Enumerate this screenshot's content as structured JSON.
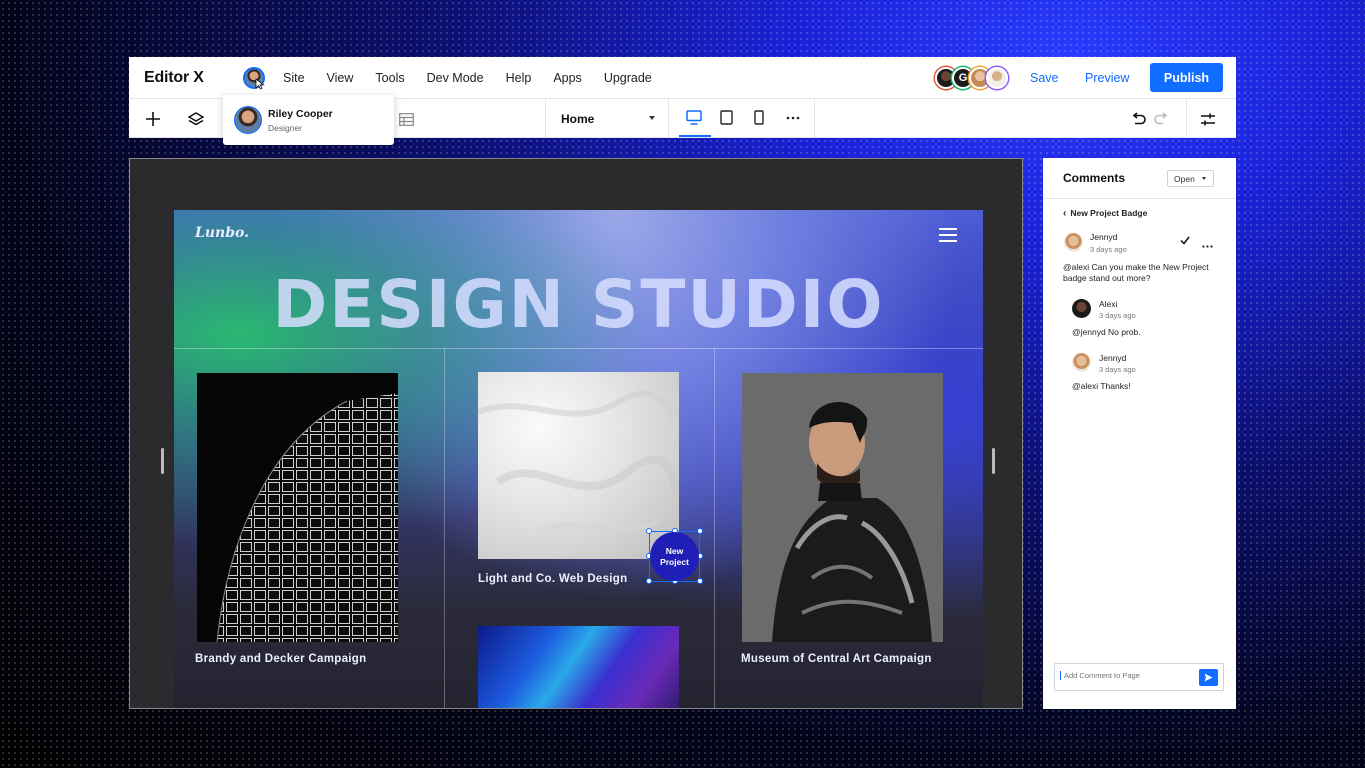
{
  "app": {
    "name": "Editor X"
  },
  "menu": [
    "Site",
    "View",
    "Tools",
    "Dev Mode",
    "Help",
    "Apps",
    "Upgrade"
  ],
  "collaborators": [
    {
      "name": "avatar-1",
      "ring": "#e8503a"
    },
    {
      "initial": "G",
      "ring": "#19b873"
    },
    {
      "name": "avatar-3",
      "ring": "#f2a12b"
    },
    {
      "name": "avatar-4",
      "ring": "#8a5cff"
    }
  ],
  "actions": {
    "save": "Save",
    "preview": "Preview",
    "publish": "Publish"
  },
  "user_popover": {
    "name": "Riley Cooper",
    "role": "Designer"
  },
  "toolbar": {
    "page": "Home"
  },
  "site": {
    "logo": "Lunbo.",
    "hero": "DESIGN STUDIO",
    "cards": [
      {
        "caption": "Brandy and Decker Campaign"
      },
      {
        "caption": "Light and Co. Web Design"
      },
      {
        "caption": "Museum of Central Art Campaign"
      }
    ],
    "badge": [
      "New",
      "Project"
    ]
  },
  "comments": {
    "title": "Comments",
    "filter": "Open",
    "thread": "New Project Badge",
    "items": [
      {
        "author": "Jennyd",
        "time": "3 days ago",
        "text": "@alexi Can you make the New Project badge stand out more?"
      },
      {
        "author": "Alexi",
        "time": "3 days ago",
        "text": "@jennyd No prob."
      },
      {
        "author": "Jennyd",
        "time": "3 days ago",
        "text": "@alexi Thanks!"
      }
    ],
    "input_placeholder": "Add Comment to Page"
  },
  "colors": {
    "accent": "#116dff",
    "badge": "#1f1fb8"
  }
}
